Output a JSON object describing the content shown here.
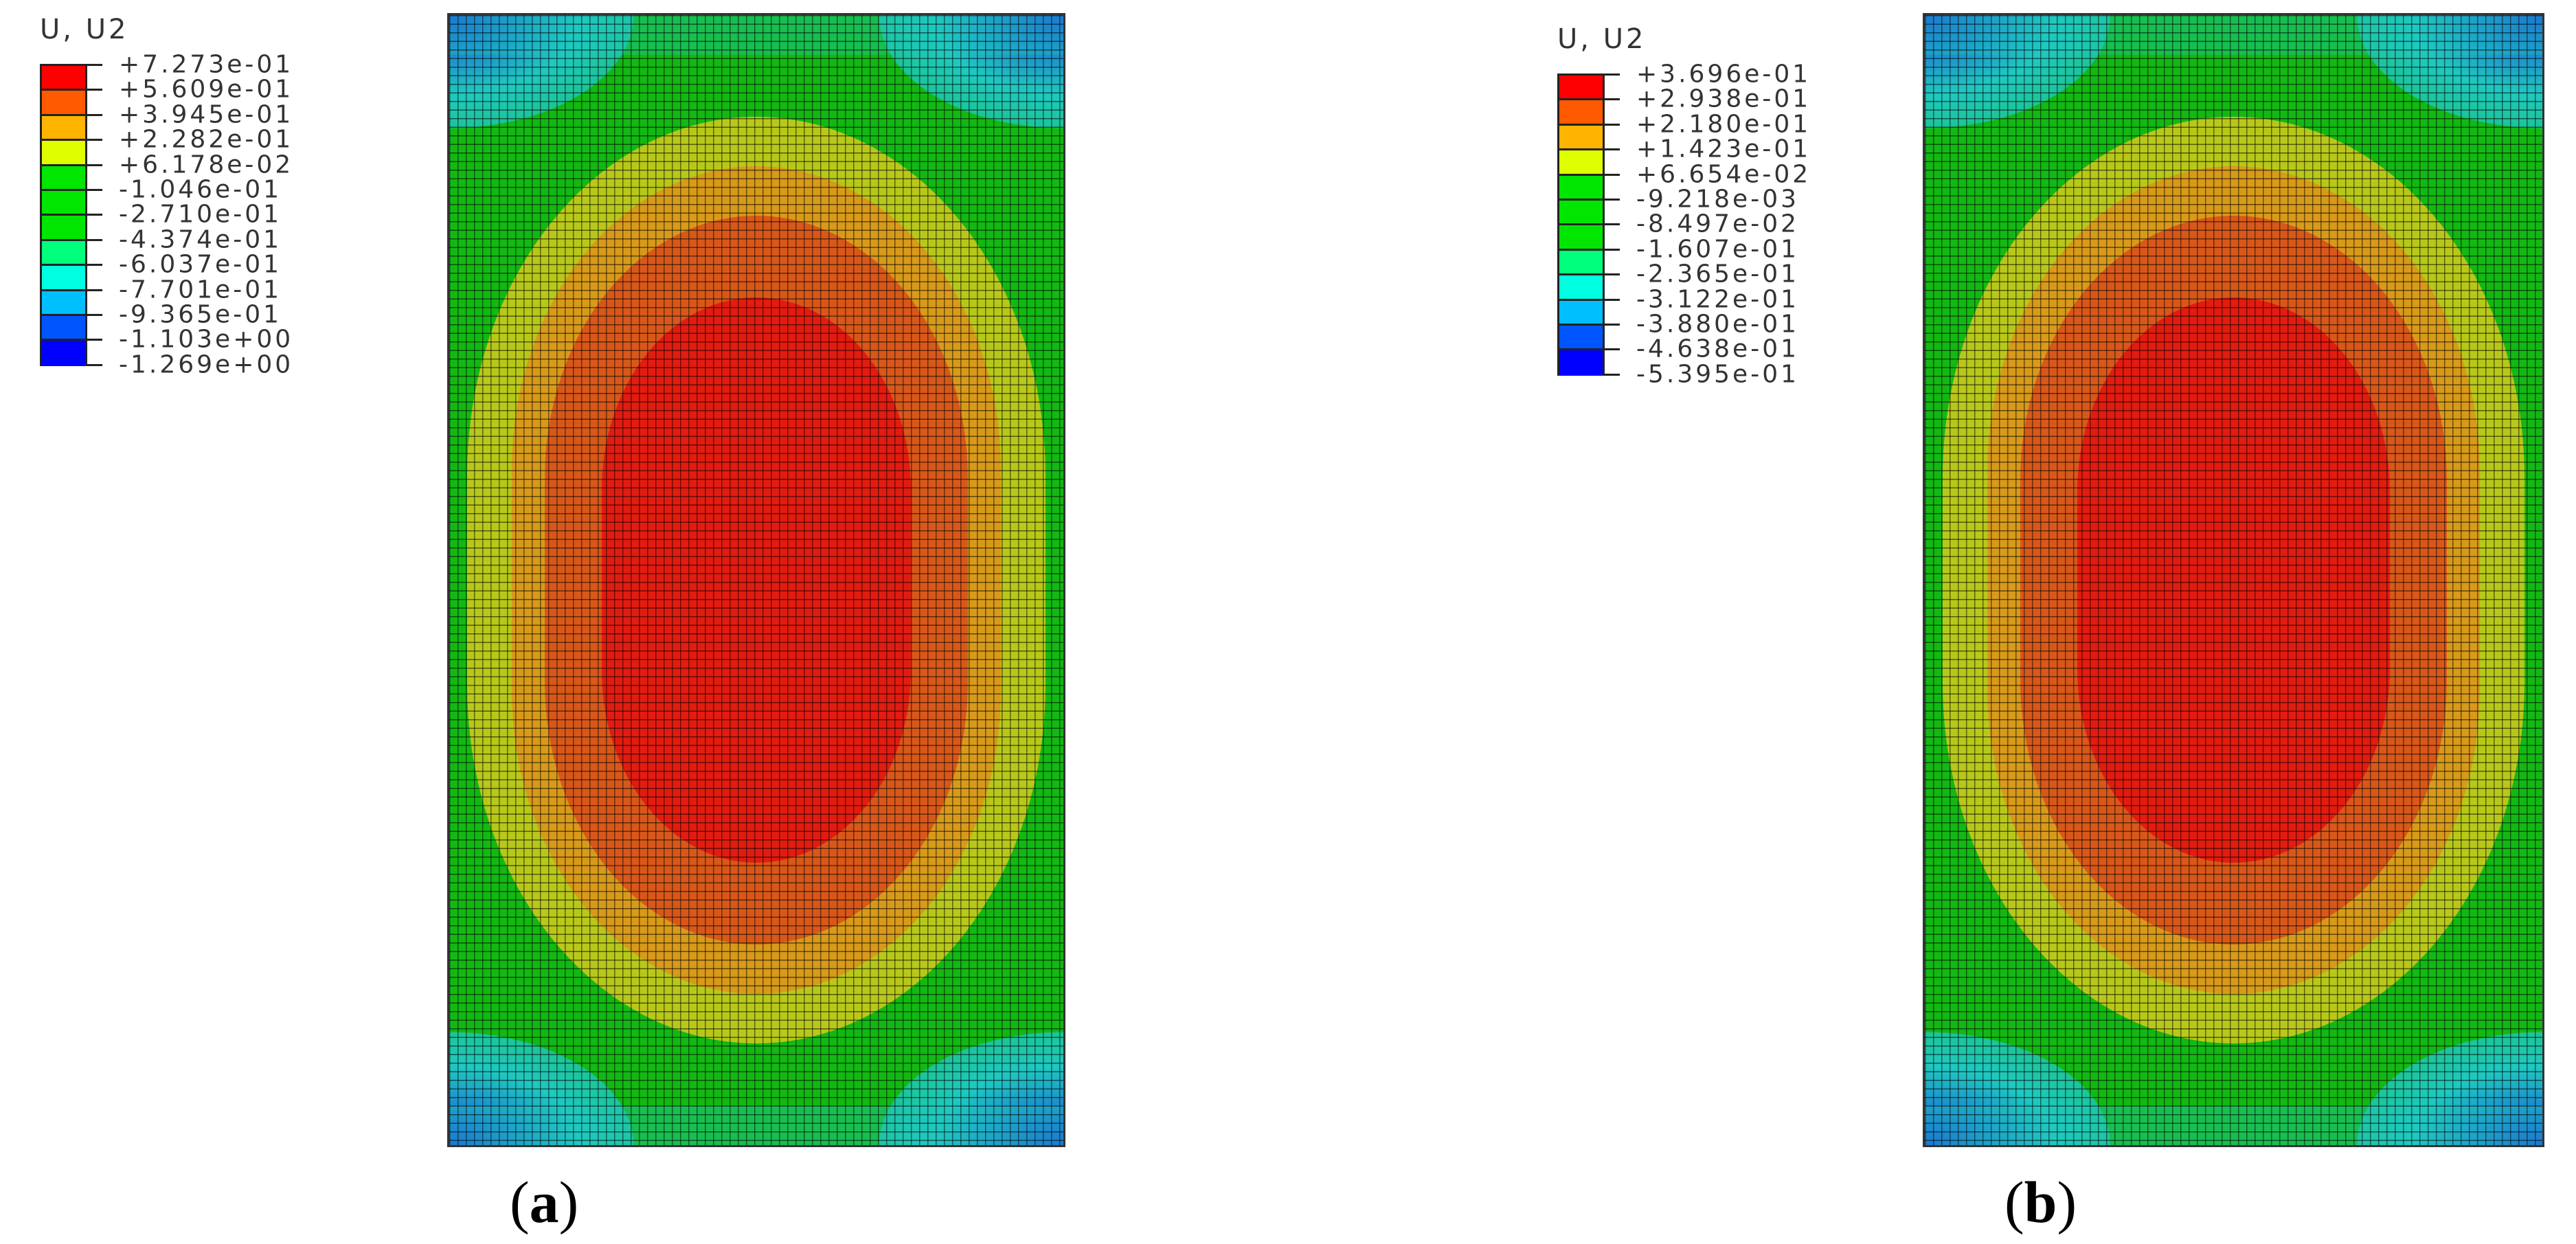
{
  "chart_data": [
    {
      "type": "heatmap",
      "title": "U, U2",
      "caption_letter": "a",
      "legend_labels": [
        "+7.273e-01",
        "+5.609e-01",
        "+3.945e-01",
        "+2.282e-01",
        "+6.178e-02",
        "-1.046e-01",
        "-2.710e-01",
        "-4.374e-01",
        "-6.037e-01",
        "-7.701e-01",
        "-9.365e-01",
        "-1.103e+00",
        "-1.269e+00"
      ],
      "legend_values": [
        0.7273,
        0.5609,
        0.3945,
        0.2282,
        0.06178,
        -0.1046,
        -0.271,
        -0.4374,
        -0.6037,
        -0.7701,
        -0.9365,
        -1.103,
        -1.269
      ],
      "range": [
        -1.269,
        0.7273
      ],
      "pattern": "concentric elliptical contours, maximum at center, minimum at corners"
    },
    {
      "type": "heatmap",
      "title": "U, U2",
      "caption_letter": "b",
      "legend_labels": [
        "+3.696e-01",
        "+2.938e-01",
        "+2.180e-01",
        "+1.423e-01",
        "+6.654e-02",
        "-9.218e-03",
        "-8.497e-02",
        "-1.607e-01",
        "-2.365e-01",
        "-3.122e-01",
        "-3.880e-01",
        "-4.638e-01",
        "-5.395e-01"
      ],
      "legend_values": [
        0.3696,
        0.2938,
        0.218,
        0.1423,
        0.06654,
        -0.009218,
        -0.08497,
        -0.1607,
        -0.2365,
        -0.3122,
        -0.388,
        -0.4638,
        -0.5395
      ],
      "range": [
        -0.5395,
        0.3696
      ],
      "pattern": "concentric elliptical contours, maximum at center, minimum at corners"
    }
  ],
  "legend_colors": [
    "#ff0000",
    "#ff5a00",
    "#ffb400",
    "#dfff00",
    "#00e600",
    "#00e600",
    "#00e600",
    "#00ff7c",
    "#00ffe0",
    "#00bfff",
    "#0055ff",
    "#0000ff"
  ],
  "plot_colors": {
    "green": "#14b814",
    "yellow": "#b8c81a",
    "orange": "#d89a1a",
    "dark_orange": "#d8581a",
    "red": "#e21c10",
    "cyan": "#1fc8c0",
    "blue": "#1a4fd8"
  }
}
